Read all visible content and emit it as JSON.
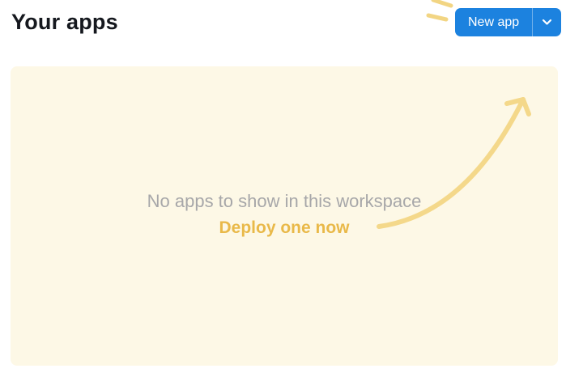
{
  "page": {
    "title": "Your apps"
  },
  "toolbar": {
    "new_app_label": "New app",
    "dropdown_icon": "chevron-down",
    "decoration_icon": "sparkle-rays"
  },
  "empty_state": {
    "message": "No apps to show in this workspace",
    "cta_label": "Deploy one now",
    "arrow_icon": "hand-drawn-arrow-up-right"
  },
  "colors": {
    "primary_button_blue": "#1c82df",
    "button_text": "#ffffff",
    "title_text": "#15181e",
    "panel_background": "#fdf8e6",
    "message_gray": "#a7a7a9",
    "cta_gold": "#e9b949",
    "arrow_yellow": "#f4d88a",
    "page_background": "#ffffff"
  }
}
